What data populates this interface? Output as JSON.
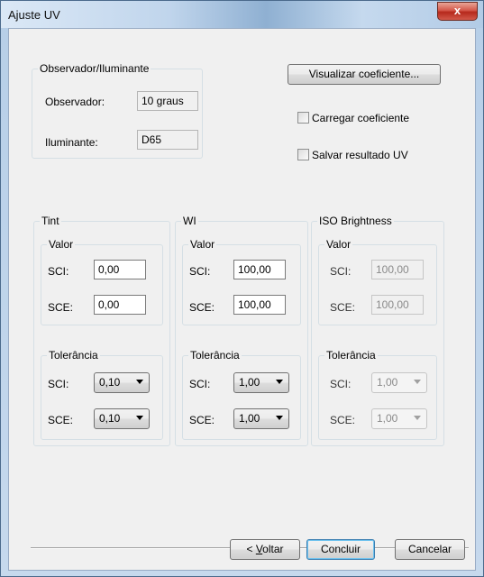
{
  "window": {
    "title": "Ajuste UV",
    "close_glyph": "x"
  },
  "observer_group": {
    "title": "Observador/Iluminante",
    "observer_label": "Observador:",
    "observer_value": "10 graus",
    "illuminant_label": "Iluminante:",
    "illuminant_value": "D65"
  },
  "options": {
    "view_coeff_button": "Visualizar coeficiente...",
    "load_coeff_label": "Carregar coeficiente",
    "save_uv_label": "Salvar resultado UV"
  },
  "tint": {
    "title": "Tint",
    "value_title": "Valor",
    "sci_label": "SCI:",
    "sci_value": "0,00",
    "sce_label": "SCE:",
    "sce_value": "0,00",
    "tol_title": "Tolerância",
    "tol_sci_label": "SCI:",
    "tol_sci_value": "0,10",
    "tol_sce_label": "SCE:",
    "tol_sce_value": "0,10"
  },
  "wi": {
    "title": "WI",
    "value_title": "Valor",
    "sci_label": "SCI:",
    "sci_value": "100,00",
    "sce_label": "SCE:",
    "sce_value": "100,00",
    "tol_title": "Tolerância",
    "tol_sci_label": "SCI:",
    "tol_sci_value": "1,00",
    "tol_sce_label": "SCE:",
    "tol_sce_value": "1,00"
  },
  "iso": {
    "title": "ISO Brightness",
    "value_title": "Valor",
    "sci_label": "SCI:",
    "sci_value": "100,00",
    "sce_label": "SCE:",
    "sce_value": "100,00",
    "tol_title": "Tolerância",
    "tol_sci_label": "SCI:",
    "tol_sci_value": "1,00",
    "tol_sce_label": "SCE:",
    "tol_sce_value": "1,00"
  },
  "footer": {
    "back_prefix": "< ",
    "back_mnemonic": "V",
    "back_rest": "oltar",
    "finish_label": "Concluir",
    "cancel_label": "Cancelar"
  },
  "colors": {
    "accent": "#3c7fb1",
    "close_red": "#c43b2e",
    "panel": "#f0f0f0"
  }
}
